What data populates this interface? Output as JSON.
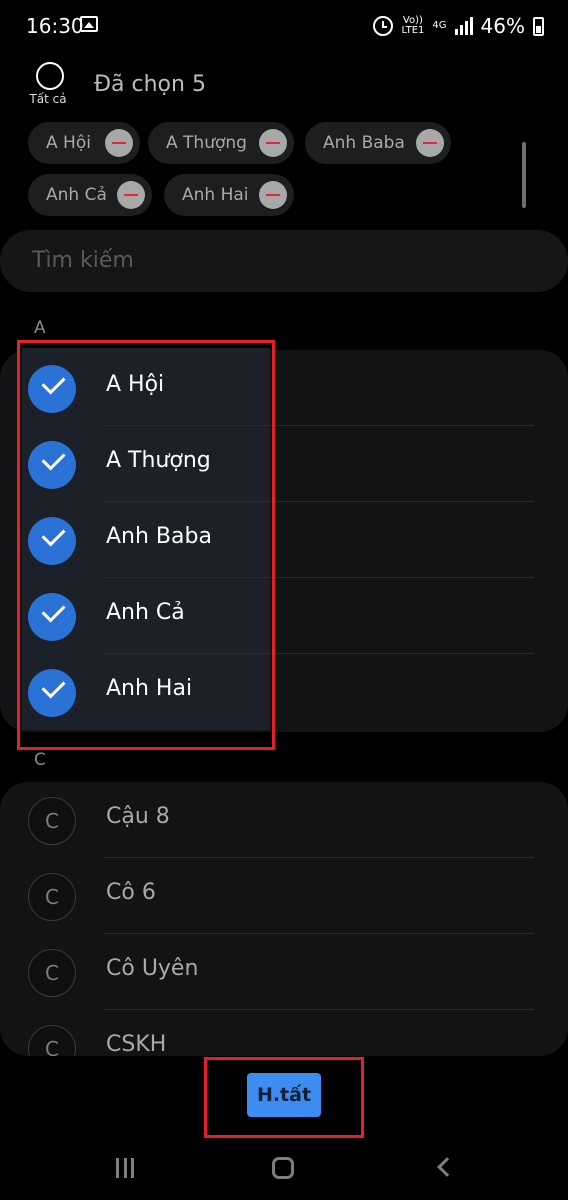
{
  "status_bar": {
    "time": "16:30",
    "network_top": "Vo))",
    "network_bottom": "LTE1",
    "network_type": "4G",
    "battery": "46%",
    "icons": [
      "gallery-icon",
      "alarm-icon",
      "signal-icon",
      "battery-icon"
    ]
  },
  "header": {
    "select_all_label": "Tất cả",
    "title": "Đã chọn 5"
  },
  "chips": [
    {
      "label": "A Hội"
    },
    {
      "label": "A Thượng"
    },
    {
      "label": "Anh Baba"
    },
    {
      "label": "Anh Cả"
    },
    {
      "label": "Anh Hai"
    }
  ],
  "search": {
    "placeholder": "Tìm kiếm"
  },
  "sections": [
    {
      "letter": "A",
      "contacts": [
        {
          "name": "A Hội",
          "selected": true
        },
        {
          "name": "A Thượng",
          "selected": true
        },
        {
          "name": "Anh Baba",
          "selected": true
        },
        {
          "name": "Anh Cả",
          "selected": true
        },
        {
          "name": "Anh Hai",
          "selected": true
        }
      ]
    },
    {
      "letter": "C",
      "contacts": [
        {
          "name": "Cậu 8",
          "initial": "C",
          "selected": false
        },
        {
          "name": "Cô 6",
          "initial": "C",
          "selected": false
        },
        {
          "name": "Cô Uyên",
          "initial": "C",
          "selected": false
        },
        {
          "name": "CSKH",
          "initial": "C",
          "selected": false
        }
      ]
    }
  ],
  "done_button": {
    "label": "H.tất"
  },
  "colors": {
    "accent": "#2b72d6",
    "done_button": "#3d8cf1",
    "highlight_frame": "#e2202c",
    "chip_remove": "#e4273a"
  }
}
